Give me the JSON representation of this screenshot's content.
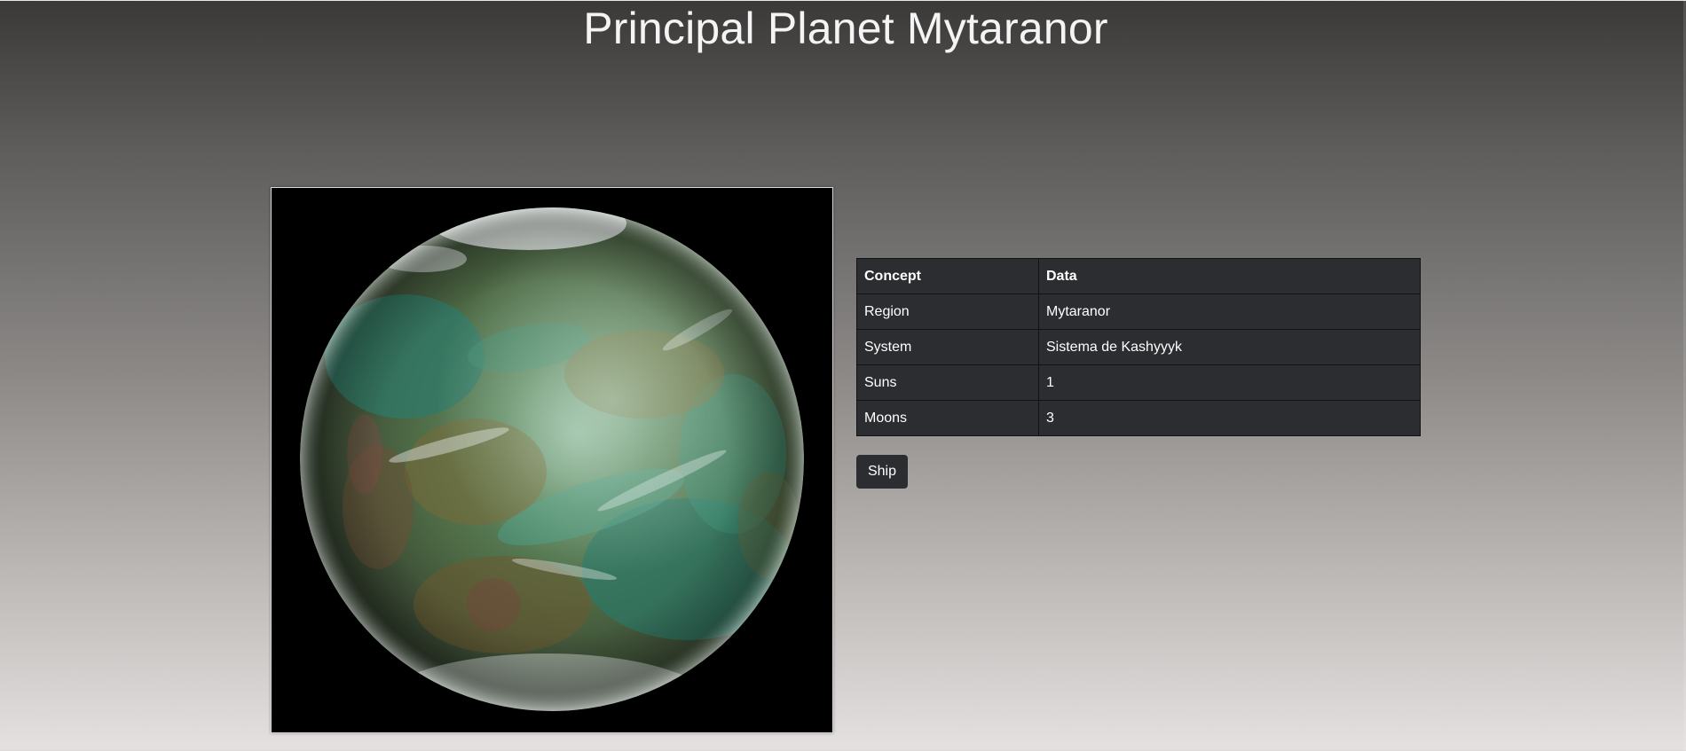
{
  "page": {
    "title": "Principal Planet Mytaranor"
  },
  "planet_image": {
    "alt": "Planet Mytaranor",
    "colors": {
      "background": "#000000",
      "ocean": "#2f7a68",
      "land": "#6e6235",
      "cloud": "#e6eaea"
    }
  },
  "info_table": {
    "headers": [
      "Concept",
      "Data"
    ],
    "rows": [
      {
        "concept": "Region",
        "data": "Mytaranor"
      },
      {
        "concept": "System",
        "data": "Sistema de Kashyyyk"
      },
      {
        "concept": "Suns",
        "data": "1"
      },
      {
        "concept": "Moons",
        "data": "3"
      }
    ]
  },
  "actions": {
    "ship_label": "Ship"
  },
  "theme": {
    "table_bg": "#2b2d30",
    "button_bg": "#2b2d30",
    "text": "#ffffff"
  }
}
